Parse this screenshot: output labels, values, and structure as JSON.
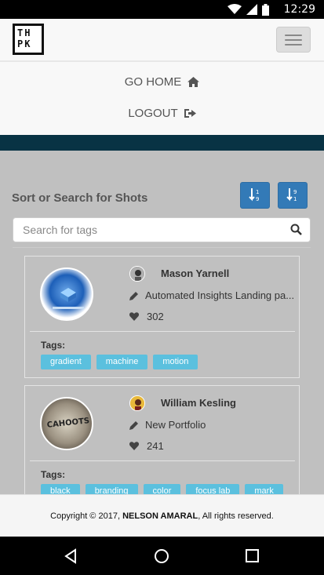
{
  "status_bar": {
    "time": "12:29",
    "icons": [
      "wifi-icon",
      "signal-icon",
      "battery-icon"
    ]
  },
  "navbar": {
    "logo_text": "TH PK",
    "menu_icon": "hamburger-icon"
  },
  "menu": {
    "items": [
      {
        "label": "GO HOME",
        "icon": "home-icon"
      },
      {
        "label": "LOGOUT",
        "icon": "sign-out-icon"
      }
    ]
  },
  "main": {
    "sort_title": "Sort or Search for Shots",
    "sort_buttons": [
      {
        "icon": "sort-numeric-asc-icon"
      },
      {
        "icon": "sort-numeric-desc-icon"
      }
    ],
    "search": {
      "placeholder": "Search for tags",
      "value": ""
    },
    "shots": [
      {
        "author": "Mason Yarnell",
        "title": "Automated Insights Landing pa...",
        "likes": "302",
        "tags_label": "Tags:",
        "tags": [
          "gradient",
          "machine",
          "motion"
        ]
      },
      {
        "author": "William Kesling",
        "title": "New Portfolio",
        "thumbnail_text": "CAHOOTS",
        "likes": "241",
        "tags_label": "Tags:",
        "tags": [
          "black",
          "branding",
          "color",
          "focus lab",
          "mark"
        ]
      }
    ]
  },
  "footer": {
    "copyright_prefix": "Copyright © 2017,",
    "author": "NELSON AMARAL",
    "copyright_suffix": ", All rights reserved."
  },
  "colors": {
    "accent": "#337ab7",
    "tag": "#5bc0de",
    "band": "#083344",
    "content_bg": "#c0c0c0"
  }
}
